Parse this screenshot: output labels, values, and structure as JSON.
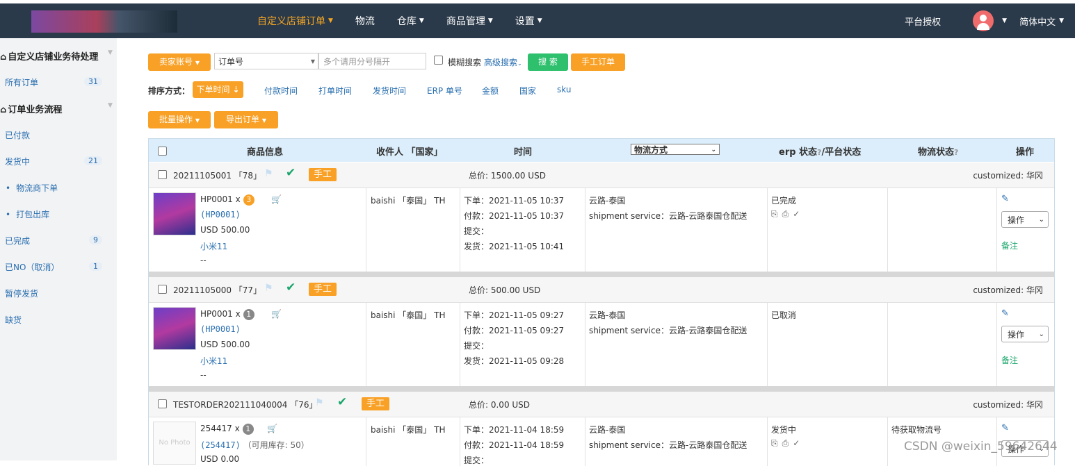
{
  "nav": {
    "items": [
      {
        "label": "自定义店铺订单",
        "active": true,
        "caret": true
      },
      {
        "label": "物流",
        "active": false,
        "caret": false
      },
      {
        "label": "仓库",
        "active": false,
        "caret": true
      },
      {
        "label": "商品管理",
        "active": false,
        "caret": true
      },
      {
        "label": "设置",
        "active": false,
        "caret": true
      }
    ],
    "platform_auth": "平台授权",
    "language": "简体中文"
  },
  "sidebar": {
    "group1": "自定义店铺业务待处理",
    "all_orders": {
      "label": "所有订单",
      "count": "31"
    },
    "group2": "订单业务流程",
    "items": [
      {
        "label": "已付款",
        "count": ""
      },
      {
        "label": "发货中",
        "count": "21"
      },
      {
        "label": "物流商下单",
        "count": ""
      },
      {
        "label": "打包出库",
        "count": ""
      },
      {
        "label": "已完成",
        "count": "9"
      },
      {
        "label": "已NO（取消）",
        "count": "1"
      },
      {
        "label": "暂停发货",
        "count": ""
      },
      {
        "label": "缺货",
        "count": ""
      }
    ]
  },
  "search": {
    "seller_account": "卖家账号",
    "field_select": "订单号",
    "placeholder": "多个请用分号隔开",
    "fuzzy": "模糊搜索",
    "advanced": "高级搜索",
    "search_btn": "搜 索",
    "manual_order": "手工订单"
  },
  "sort": {
    "label": "排序方式：",
    "active": "下单时间",
    "options": [
      "付款时间",
      "打单时间",
      "发货时间",
      "ERP 单号",
      "金额",
      "国家",
      "sku"
    ]
  },
  "actions": {
    "batch": "批量操作",
    "export": "导出订单"
  },
  "table": {
    "headers": {
      "product": "商品信息",
      "recipient": "收件人 「国家」",
      "time": "时间",
      "logistics": "物流方式",
      "status": "erp 状态",
      "platform_status": "/平台状态",
      "logistics_status": "物流状态",
      "operation": "操作"
    }
  },
  "orders": [
    {
      "order_no": "20211105001 「78」",
      "tag": "手工",
      "total": "总价: 1500.00 USD",
      "customized": "customized: 华冈",
      "sku": "HP0001 x",
      "qty": "3",
      "qty_color": "#f8a126",
      "sku_code": "(HP0001)",
      "stock": "",
      "price": "USD 500.00",
      "name": "小米11",
      "extra": "--",
      "recipient": "baishi 「泰国」 TH",
      "time_order": "下单：2021-11-05 10:37",
      "time_pay": "付款：2021-11-05 10:37",
      "time_submit": "提交：",
      "time_ship": "发货：2021-11-05 10:41",
      "carrier": "云路-泰国",
      "service": "shipment service：云路-云路泰国仓配送",
      "erp_status": "已完成",
      "logistics_status": "",
      "op": "操作",
      "note": "备注"
    },
    {
      "order_no": "20211105000 「77」",
      "tag": "手工",
      "total": "总价: 500.00 USD",
      "customized": "customized: 华冈",
      "sku": "HP0001 x",
      "qty": "1",
      "qty_color": "#888888",
      "sku_code": "(HP0001)",
      "stock": "",
      "price": "USD 500.00",
      "name": "小米11",
      "extra": "--",
      "recipient": "baishi 「泰国」 TH",
      "time_order": "下单：2021-11-05 09:27",
      "time_pay": "付款：2021-11-05 09:27",
      "time_submit": "提交：",
      "time_ship": "发货：2021-11-05 09:28",
      "carrier": "云路-泰国",
      "service": "shipment service：云路-云路泰国仓配送",
      "erp_status": "已取消",
      "logistics_status": "",
      "op": "操作",
      "note": "备注"
    },
    {
      "order_no": "TESTORDER202111040004 「76」",
      "tag": "手工",
      "total": "总价: 0.00 USD",
      "customized": "customized: 华冈",
      "sku": "254417 x",
      "qty": "1",
      "qty_color": "#888888",
      "sku_code": "(254417)",
      "stock": "（可用库存: 50）",
      "price": "USD 0.00",
      "name": "",
      "extra": "",
      "recipient": "baishi 「泰国」 TH",
      "time_order": "下单：2021-11-04 18:59",
      "time_pay": "付款：2021-11-04 18:59",
      "time_submit": "提交：",
      "time_ship": "",
      "carrier": "云路-泰国",
      "service": "shipment service：云路-云路泰国仓配送",
      "erp_status": "发货中",
      "logistics_status": "待获取物流号",
      "op": "操作",
      "note": ""
    }
  ],
  "no_photo": "No Photo",
  "watermark": "CSDN @weixin_59642644"
}
